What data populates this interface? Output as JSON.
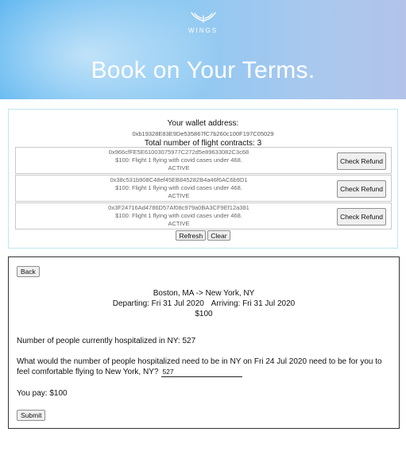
{
  "brand": {
    "name": "WINGS",
    "logo_icon": "wings-logo-icon"
  },
  "hero": {
    "title": "Book on Your Terms."
  },
  "wallet": {
    "label": "Your wallet address:",
    "address": "0xb19328E83E9De535867fC7b260c100F197C05029",
    "contracts_label": "Total number of flight contracts:",
    "contracts_count": "3",
    "contracts": [
      {
        "address": "0x966cfFE5E61003075977C272d5e89633082C3c68",
        "description": "$100: Flight 1 flying with covid cases under 468.",
        "status": "ACTIVE",
        "button_label": "Check Refund"
      },
      {
        "address": "0x38c531b908C48ef45EB845282B4a46f6AC6b9D1",
        "description": "$100: Flight 1 flying with covid cases under 468.",
        "status": "ACTIVE",
        "button_label": "Check Refund"
      },
      {
        "address": "0x3F24716Ad4786D57Af08c979a0BA3CF9Ef12a381",
        "description": "$100: Flight 1 flying with covid cases under 468.",
        "status": "ACTIVE",
        "button_label": "Check Refund"
      }
    ],
    "refresh_label": "Refresh",
    "clear_label": "Clear"
  },
  "flight": {
    "back_label": "Back",
    "route": "Boston, MA -> New York, NY",
    "departing": "Departing: Fri 31 Jul 2020",
    "arriving": "Arriving: Fri 31 Jul 2020",
    "price": "$100",
    "hospitalized_line": "Number of people currently hospitalized in NY: 527",
    "question": "What would the number of people hospitalized need to be in NY on Fri 24 Jul 2020 need to be for you to feel comfortable flying to New York, NY?",
    "input_value": "527",
    "you_pay": "You pay: $100",
    "submit_label": "Submit"
  },
  "colors": {
    "hero_left": "#5eb6f0",
    "hero_right": "#b3c3ea",
    "wallet_border": "#bfe6ef"
  }
}
